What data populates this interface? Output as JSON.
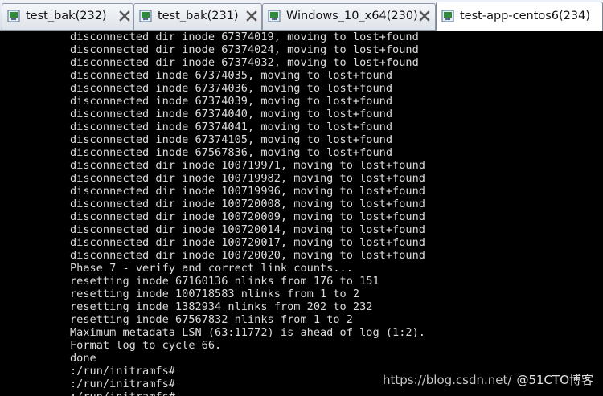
{
  "tabs": [
    {
      "label": "test_bak(232)",
      "icon": "vm-tab-icon",
      "active": false
    },
    {
      "label": "test_bak(231)",
      "icon": "vm-tab-icon",
      "active": false
    },
    {
      "label": "Windows_10_x64(230)",
      "icon": "vm-tab-icon",
      "active": false
    },
    {
      "label": "test-app-centos6(234)",
      "icon": "vm-tab-icon",
      "active": true
    }
  ],
  "terminal": {
    "lines": [
      "disconnected dir inode 67374019, moving to lost+found",
      "disconnected dir inode 67374024, moving to lost+found",
      "disconnected dir inode 67374032, moving to lost+found",
      "disconnected inode 67374035, moving to lost+found",
      "disconnected inode 67374036, moving to lost+found",
      "disconnected inode 67374039, moving to lost+found",
      "disconnected inode 67374040, moving to lost+found",
      "disconnected inode 67374041, moving to lost+found",
      "disconnected inode 67374105, moving to lost+found",
      "disconnected inode 67567836, moving to lost+found",
      "disconnected dir inode 100719971, moving to lost+found",
      "disconnected dir inode 100719982, moving to lost+found",
      "disconnected dir inode 100719996, moving to lost+found",
      "disconnected dir inode 100720008, moving to lost+found",
      "disconnected dir inode 100720009, moving to lost+found",
      "disconnected dir inode 100720014, moving to lost+found",
      "disconnected dir inode 100720017, moving to lost+found",
      "disconnected dir inode 100720020, moving to lost+found",
      "Phase 7 - verify and correct link counts...",
      "resetting inode 67160136 nlinks from 176 to 151",
      "resetting inode 100718583 nlinks from 1 to 2",
      "resetting inode 1382934 nlinks from 202 to 232",
      "resetting inode 67567832 nlinks from 1 to 2",
      "Maximum metadata LSN (63:11772) is ahead of log (1:2).",
      "Format log to cycle 66.",
      "done",
      ":/run/initramfs#",
      ":/run/initramfs#",
      ":/run/initramfs#"
    ]
  },
  "watermark": {
    "url": "https://blog.csdn.net/",
    "brand": "@51CTO博客"
  },
  "colors": {
    "terminal_bg": "#000000",
    "terminal_fg": "#dcdcdc",
    "close_icon": "#555555"
  }
}
